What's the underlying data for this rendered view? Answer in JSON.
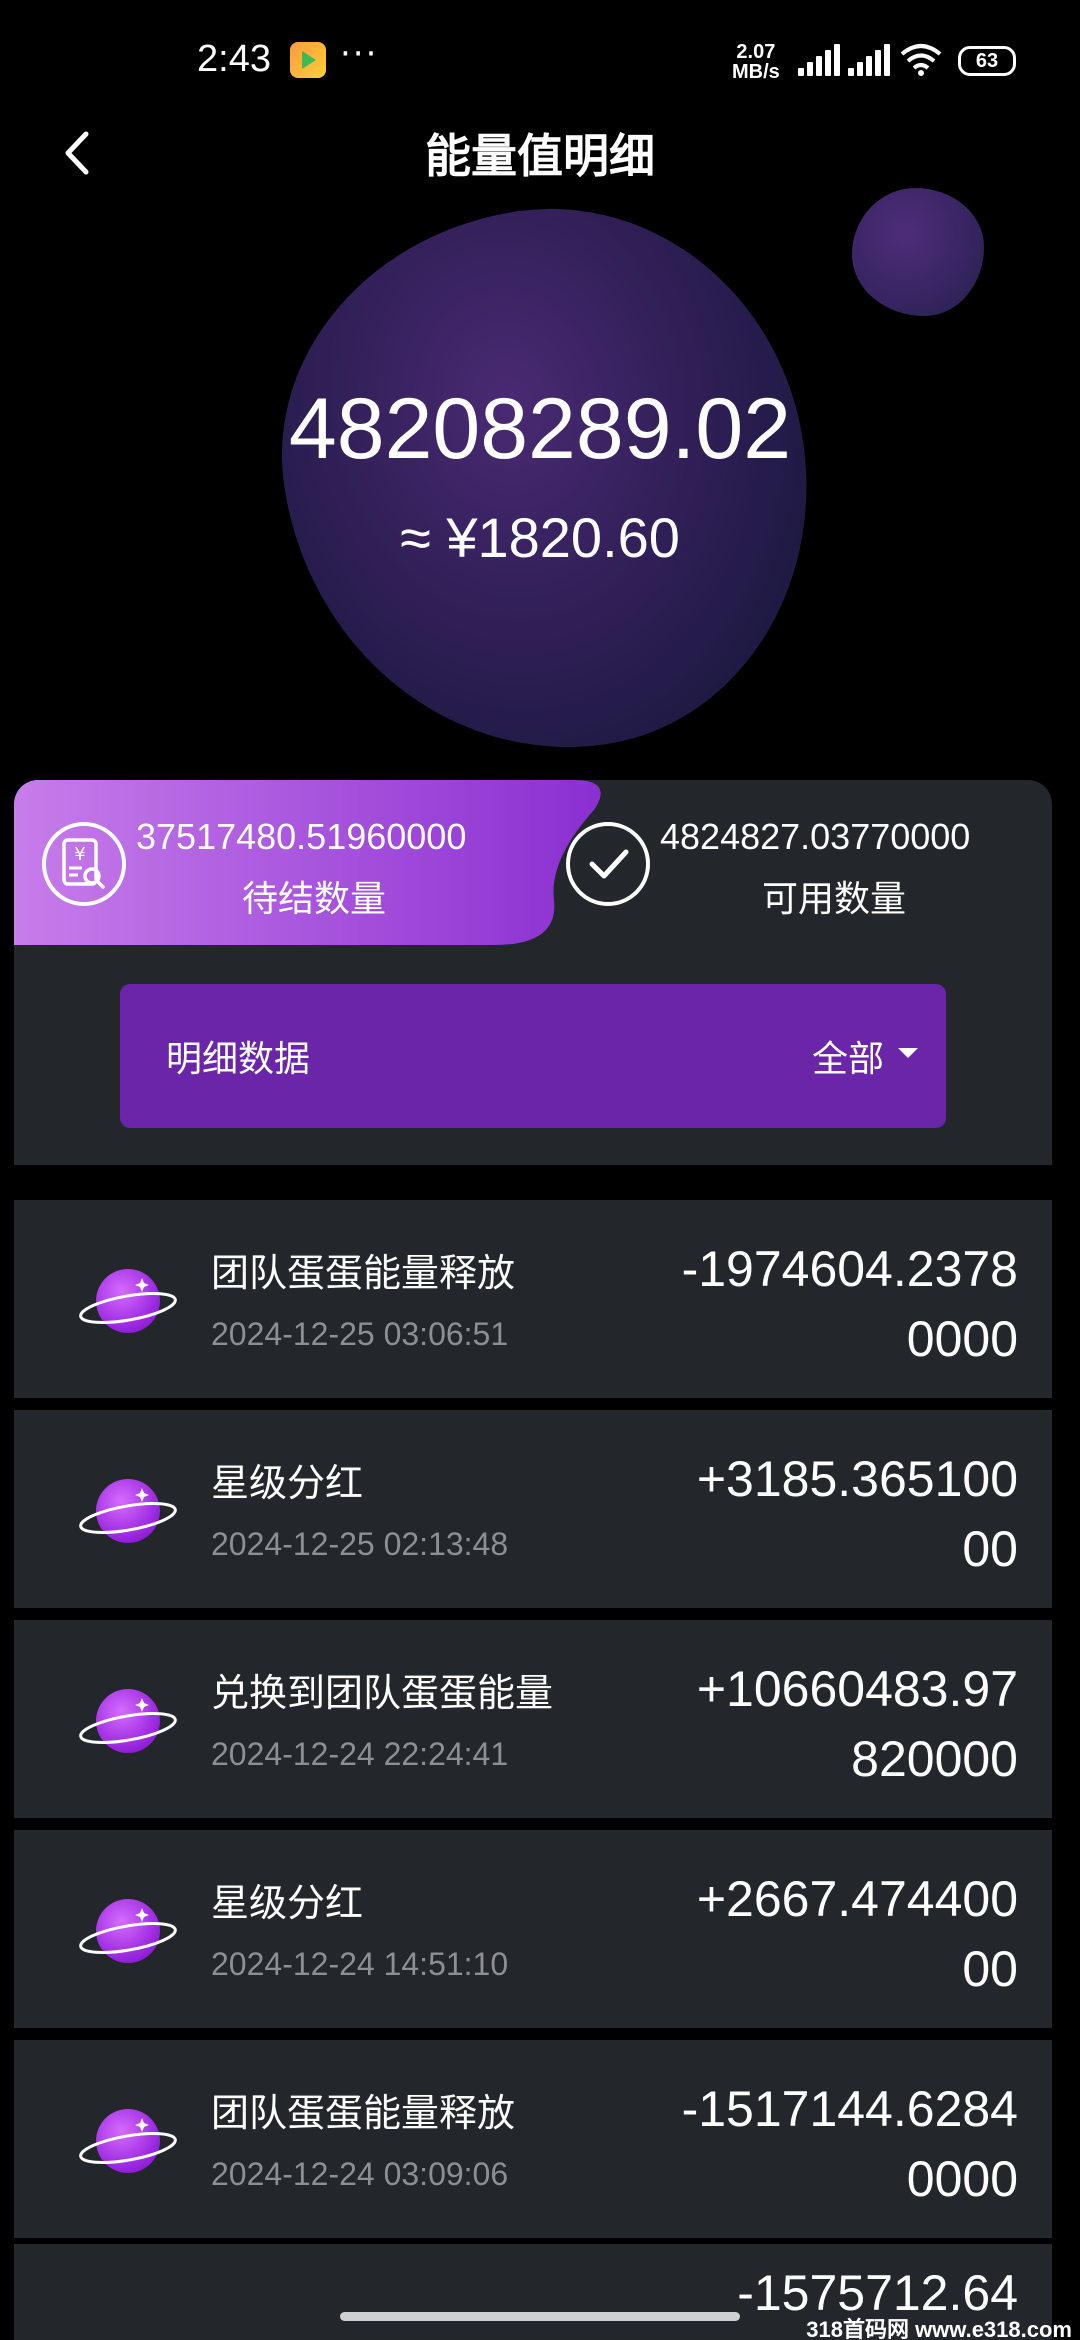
{
  "status_bar": {
    "time": "2:43",
    "more": "···",
    "net_speed_value": "2.07",
    "net_speed_unit": "MB/s",
    "battery": "63"
  },
  "header": {
    "title": "能量值明细"
  },
  "balance": {
    "total": "48208289.02",
    "cny_equivalent": "≈ ¥1820.60"
  },
  "summary": {
    "pending": {
      "value": "37517480.51960000",
      "label": "待结数量"
    },
    "available": {
      "value": "4824827.03770000",
      "label": "可用数量"
    }
  },
  "detail_bar": {
    "title": "明细数据",
    "filter_selected": "全部"
  },
  "records": [
    {
      "title": "团队蛋蛋能量释放",
      "time": "2024-12-25 03:06:51",
      "amount": "-1974604.23780000"
    },
    {
      "title": "星级分红",
      "time": "2024-12-25 02:13:48",
      "amount": "+3185.36510000"
    },
    {
      "title": "兑换到团队蛋蛋能量",
      "time": "2024-12-24 22:24:41",
      "amount": "+10660483.97820000"
    },
    {
      "title": "星级分红",
      "time": "2024-12-24 14:51:10",
      "amount": "+2667.47440000"
    },
    {
      "title": "团队蛋蛋能量释放",
      "time": "2024-12-24 03:09:06",
      "amount": "-1517144.62840000"
    }
  ],
  "peek_amount": "-1575712.64",
  "watermark": "318首码网 www.e318.com",
  "colors": {
    "accent_purple": "#6a25a8",
    "card_bg": "#23262a",
    "tab_gradient_start": "#c77dea",
    "tab_gradient_end": "#8a2fd1"
  }
}
